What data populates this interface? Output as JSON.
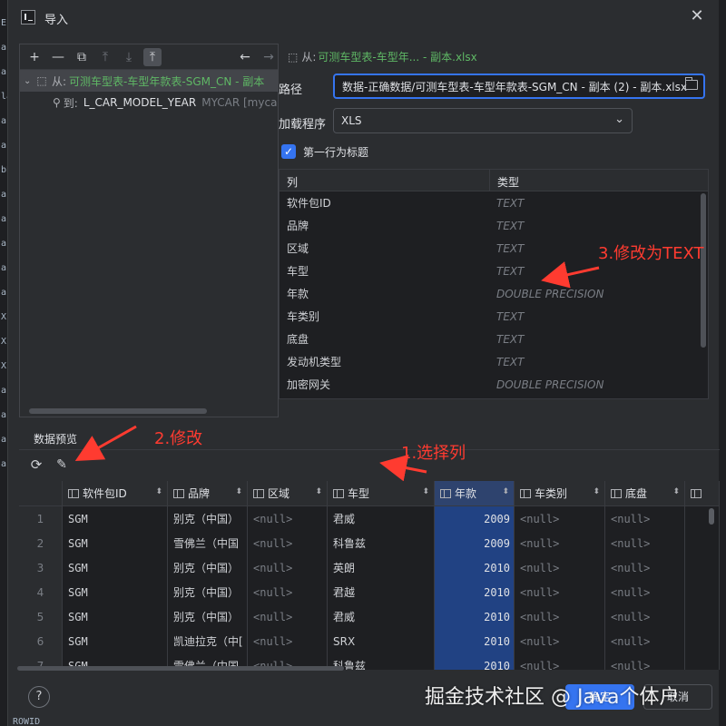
{
  "window": {
    "title": "导入",
    "close_glyph": "✕"
  },
  "edge_glyphs": [
    "E",
    "a|",
    "a|",
    "la",
    "a|",
    "a|",
    "bE",
    "a|",
    "a|",
    "a|",
    "a|",
    "a|",
    "X",
    "X",
    "X",
    "a|",
    "a|",
    "a|",
    "a|"
  ],
  "toolbar": {
    "add": "+",
    "remove": "—",
    "copy": "⧉",
    "up": "⤒",
    "down": "⤓",
    "move_top": "⤒",
    "back": "←",
    "forward": "→"
  },
  "mapping_tree": {
    "source": {
      "prefix": "从:",
      "name": "可测车型表-车型年款表-SGM_CN - 副本"
    },
    "target": {
      "prefix": "到:",
      "name": "L_CAR_MODEL_YEAR",
      "schema": "MYCAR [mycar"
    }
  },
  "properties": {
    "source_title_prefix": "从:",
    "source_title": "可测车型表-车型年... - 副本.xlsx",
    "path_label": "路径",
    "path_value": "数据-正确数据/可测车型表-车型年款表-SGM_CN - 副本 (2) - 副本.xlsx",
    "loader_label": "加载程序",
    "loader_value": "XLS",
    "first_row_header_label": "第一行为标题",
    "first_row_header_checked": true
  },
  "columns_table": {
    "headers": [
      "列",
      "类型"
    ],
    "rows": [
      {
        "name": "软件包ID",
        "type": "TEXT"
      },
      {
        "name": "品牌",
        "type": "TEXT"
      },
      {
        "name": "区域",
        "type": "TEXT"
      },
      {
        "name": "车型",
        "type": "TEXT"
      },
      {
        "name": "年款",
        "type": "DOUBLE PRECISION"
      },
      {
        "name": "车类别",
        "type": "TEXT"
      },
      {
        "name": "底盘",
        "type": "TEXT"
      },
      {
        "name": "发动机类型",
        "type": "TEXT"
      },
      {
        "name": "加密网关",
        "type": "DOUBLE PRECISION"
      }
    ]
  },
  "preview": {
    "label": "数据预览",
    "headers": [
      "软件包ID",
      "品牌",
      "区域",
      "车型",
      "年款",
      "车类别",
      "底盘",
      ""
    ],
    "selected_column": "年款",
    "rows": [
      [
        "1",
        "SGM",
        "别克（中国）",
        "<null>",
        "君威",
        "2009",
        "<null>",
        "<null>"
      ],
      [
        "2",
        "SGM",
        "雪佛兰（中国",
        "<null>",
        "科鲁兹",
        "2009",
        "<null>",
        "<null>"
      ],
      [
        "3",
        "SGM",
        "别克（中国）",
        "<null>",
        "英朗",
        "2010",
        "<null>",
        "<null>"
      ],
      [
        "4",
        "SGM",
        "别克（中国）",
        "<null>",
        "君越",
        "2010",
        "<null>",
        "<null>"
      ],
      [
        "5",
        "SGM",
        "别克（中国）",
        "<null>",
        "君威",
        "2010",
        "<null>",
        "<null>"
      ],
      [
        "6",
        "SGM",
        "凯迪拉克（中[",
        "<null>",
        "SRX",
        "2010",
        "<null>",
        "<null>"
      ],
      [
        "7",
        "SGM",
        "雪佛兰（中国",
        "<null>",
        "科鲁兹",
        "2010",
        "<null>",
        "<null>"
      ]
    ]
  },
  "footer": {
    "help": "?",
    "ok": "确定",
    "cancel": "取消"
  },
  "watermark": "掘金技术社区 @ Java个体户",
  "rowid_text": "ROWID",
  "annotations": {
    "step1": "1.选择列",
    "step2": "2.修改",
    "step3": "3.修改为TEXT",
    "color": "#ff3b30"
  }
}
